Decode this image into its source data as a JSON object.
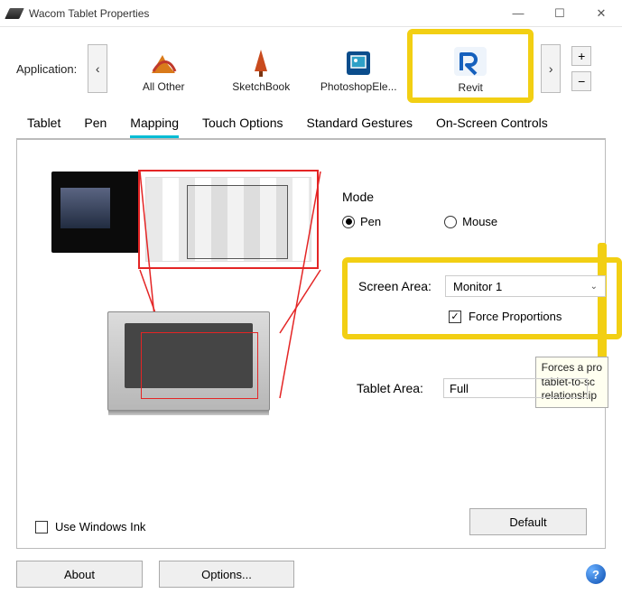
{
  "window": {
    "title": "Wacom Tablet Properties"
  },
  "appRow": {
    "label": "Application:",
    "items": [
      {
        "label": "All Other"
      },
      {
        "label": "SketchBook"
      },
      {
        "label": "PhotoshopEle..."
      },
      {
        "label": "Revit"
      }
    ]
  },
  "tabs": [
    "Tablet",
    "Pen",
    "Mapping",
    "Touch Options",
    "Standard Gestures",
    "On-Screen Controls"
  ],
  "activeTab": "Mapping",
  "mode": {
    "label": "Mode",
    "options": [
      "Pen",
      "Mouse"
    ],
    "selected": "Pen"
  },
  "screenArea": {
    "label": "Screen Area:",
    "value": "Monitor 1",
    "forceLabel": "Force Proportions",
    "forceChecked": true
  },
  "tabletArea": {
    "label": "Tablet Area:",
    "value": "Full"
  },
  "tooltip": {
    "line1": "Forces a pro",
    "line2": "tablet-to-sc",
    "line3": "relationship"
  },
  "winInk": {
    "label": "Use Windows Ink",
    "checked": false
  },
  "buttons": {
    "default": "Default",
    "about": "About",
    "options": "Options..."
  }
}
